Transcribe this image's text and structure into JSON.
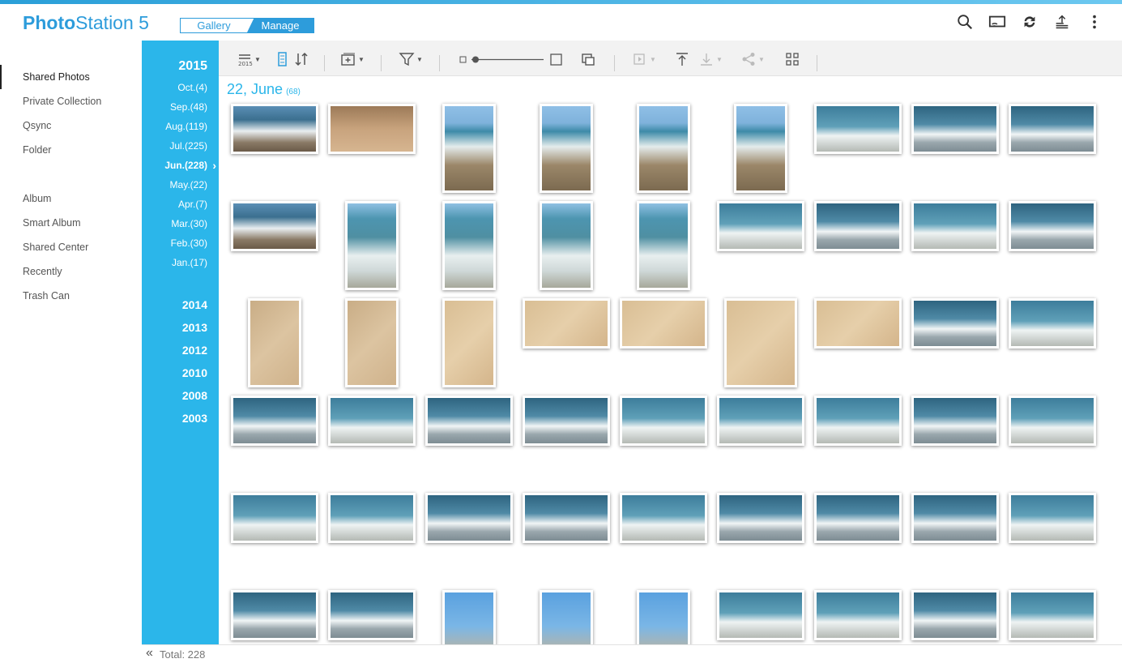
{
  "app": {
    "logo_bold": "Photo",
    "logo_rest": "Station 5"
  },
  "mode": {
    "gallery": "Gallery",
    "manage": "Manage"
  },
  "header_icons": [
    "search-icon",
    "cast-icon",
    "refresh-icon",
    "upload-stack-icon",
    "more-vert-icon"
  ],
  "sidebar": {
    "group1": [
      "Shared Photos",
      "Private Collection",
      "Qsync",
      "Folder"
    ],
    "group2": [
      "Album",
      "Smart Album",
      "Shared Center",
      "Recently",
      "Trash Can"
    ],
    "active": "Shared Photos"
  },
  "timeline": {
    "current_year": "2015",
    "months": [
      "Oct.(4)",
      "Sep.(48)",
      "Aug.(119)",
      "Jul.(225)",
      "Jun.(228)",
      "May.(22)",
      "Apr.(7)",
      "Mar.(30)",
      "Feb.(30)",
      "Jan.(17)"
    ],
    "active_month": "Jun.(228)",
    "years": [
      "2014",
      "2013",
      "2012",
      "2010",
      "2008",
      "2003"
    ]
  },
  "toolbar": {
    "timeline_icon_text": "2015",
    "icons": [
      "timeline-view-icon",
      "sort-icon",
      "add-to-album-icon",
      "filter-icon",
      "size-slider",
      "multi-select-icon",
      "slideshow-icon",
      "upload-icon",
      "download-icon",
      "share-icon",
      "qr-code-icon"
    ]
  },
  "content": {
    "date_title": "22, June",
    "count": "(68)"
  },
  "footer": {
    "total": "Total: 228"
  },
  "accent_color": "#2bb6ea"
}
